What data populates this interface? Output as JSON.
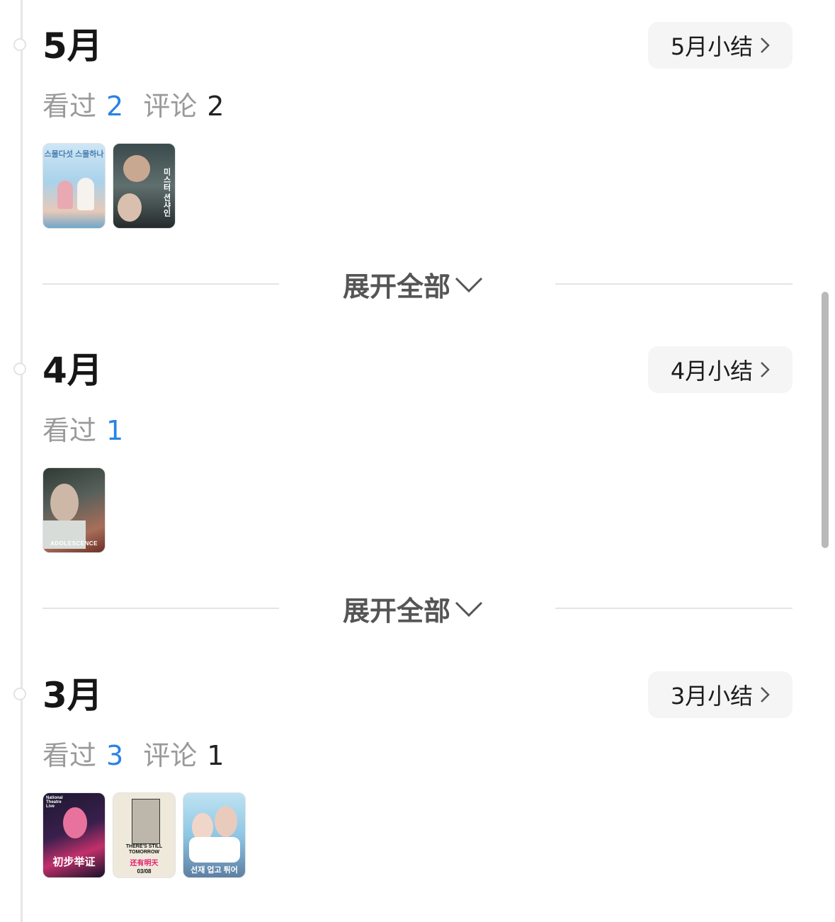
{
  "colors": {
    "accent_blue": "#2a82e4",
    "muted_text": "#9a9a9a",
    "title_text": "#161616",
    "button_bg": "#f5f5f5"
  },
  "expand_label": "展开全部",
  "months": [
    {
      "title": "5月",
      "summary_label": "5月小结",
      "watched_label": "看过",
      "watched_count": "2",
      "review_label": "评论",
      "review_count": "2",
      "posters": [
        {
          "text": "스물다섯 스물하나"
        },
        {
          "text": "미스터 션샤인"
        }
      ]
    },
    {
      "title": "4月",
      "summary_label": "4月小结",
      "watched_label": "看过",
      "watched_count": "1",
      "posters": [
        {
          "text": "ADOLESCENCE"
        }
      ]
    },
    {
      "title": "3月",
      "summary_label": "3月小结",
      "watched_label": "看过",
      "watched_count": "3",
      "review_label": "评论",
      "review_count": "1",
      "posters": [
        {
          "text": "初步举证",
          "sub": "National Theatre Live"
        },
        {
          "text": "THERE'S STILL TOMORROW",
          "sub": "还有明天",
          "date": "03/08"
        },
        {
          "text": "선재 업고 튀어"
        }
      ]
    }
  ]
}
